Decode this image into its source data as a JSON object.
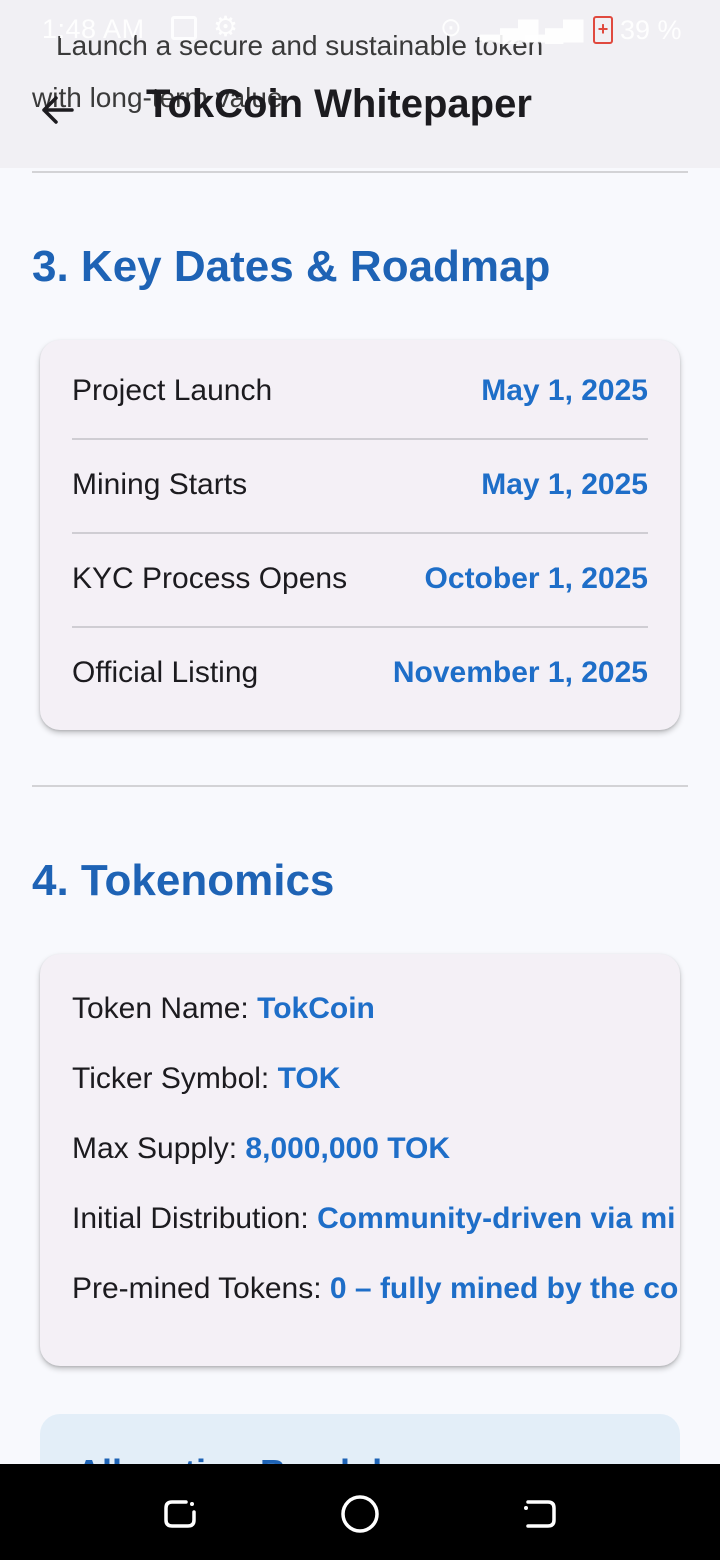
{
  "status_bar": {
    "time": "1:48 AM",
    "battery": "39 %",
    "icons": [
      "gallery-icon",
      "gear-icon",
      "hotspot-icon",
      "signal-icon",
      "signal-icon",
      "battery-icon"
    ]
  },
  "app_bar": {
    "title": "TokCoin Whitepaper",
    "back_icon": "arrow-back-icon",
    "scrolled_text_line1": "Launch a secure and sustainable token",
    "scrolled_text_line2": "with long-term value"
  },
  "roadmap": {
    "title": "3. Key Dates & Roadmap",
    "rows": [
      {
        "label": "Project Launch",
        "date": "May 1, 2025"
      },
      {
        "label": "Mining Starts",
        "date": "May 1, 2025"
      },
      {
        "label": "KYC Process Opens",
        "date": "October 1, 2025"
      },
      {
        "label": "Official Listing",
        "date": "November 1, 2025"
      }
    ]
  },
  "tokenomics": {
    "title": "4. Tokenomics",
    "items": [
      {
        "key": "Token Name: ",
        "value": "TokCoin"
      },
      {
        "key": "Ticker Symbol: ",
        "value": "TOK"
      },
      {
        "key": "Max Supply: ",
        "value": "8,000,000 TOK"
      },
      {
        "key": "Initial Distribution: ",
        "value": "Community-driven via mi"
      },
      {
        "key": "Pre-mined Tokens: ",
        "value": "0 – fully mined by the co"
      }
    ]
  },
  "allocation": {
    "title": "Allocation Breakdown"
  },
  "colors": {
    "accent": "#1e63b5",
    "value_blue": "#1e6ec8",
    "card_bg": "#f4f0f6",
    "page_bg": "#f8f9fd"
  }
}
